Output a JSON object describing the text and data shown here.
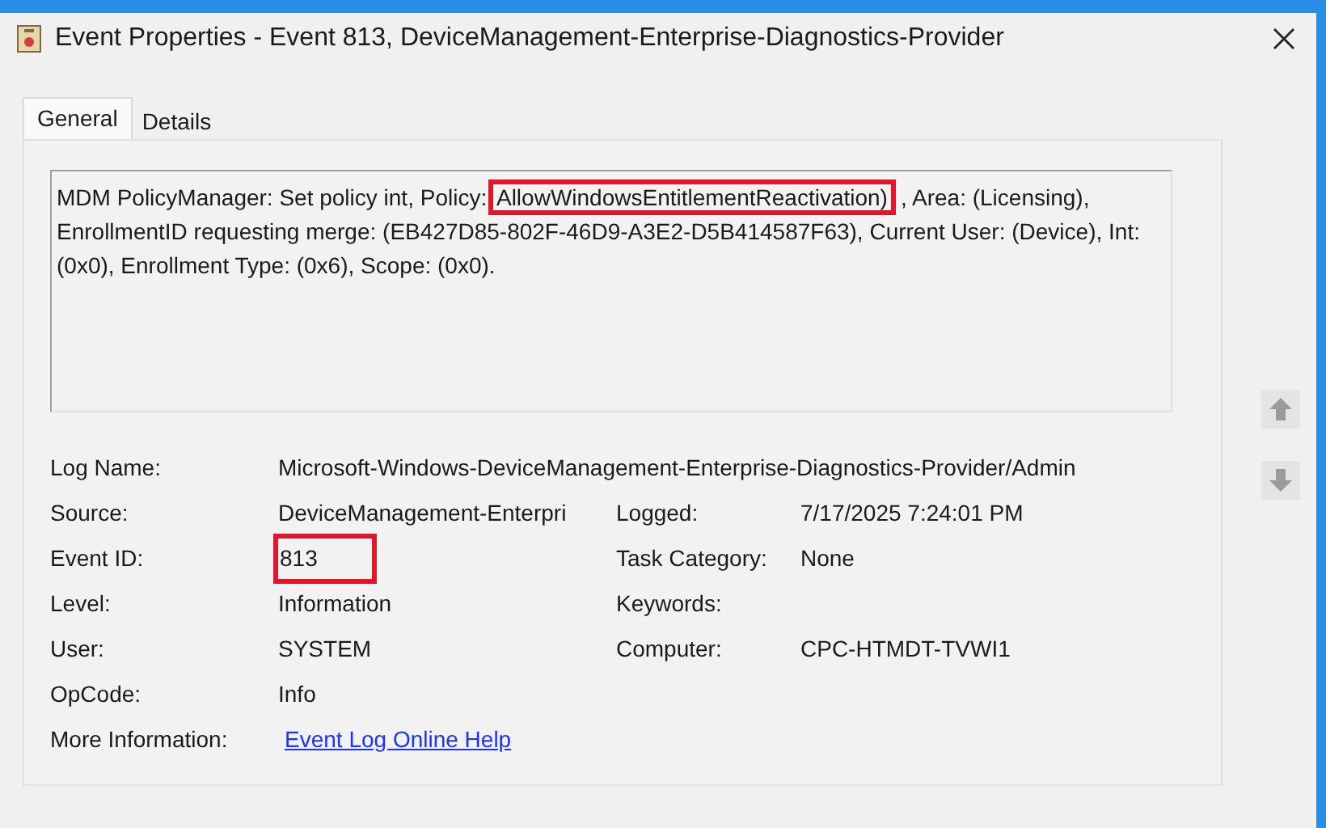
{
  "window": {
    "title": "Event Properties - Event 813, DeviceManagement-Enterprise-Diagnostics-Provider"
  },
  "tabs": [
    {
      "label": "General",
      "selected": true
    },
    {
      "label": "Details",
      "selected": false
    }
  ],
  "message": {
    "parts": [
      {
        "text": "MDM PolicyManager: Set policy int, Policy: ",
        "highlighted": false
      },
      {
        "text": "AllowWindowsEntitlementReactivation)",
        "highlighted": true
      },
      {
        "text": ", Area: (Licensing), EnrollmentID requesting merge: (EB427D85-802F-46D9-A3E2-D5B414587F63), Current User: (Device), Int: (0x0), Enrollment Type: (0x6), Scope: (0x0).",
        "highlighted": false
      }
    ]
  },
  "log_name": {
    "label": "Log Name:",
    "value": "Microsoft-Windows-DeviceManagement-Enterprise-Diagnostics-Provider/Admin"
  },
  "rows": [
    {
      "label": "Source:",
      "value": "DeviceManagement-Enterpri",
      "highlighted": false,
      "label_2": "Logged:",
      "value_2": "7/17/2025 7:24:01 PM"
    },
    {
      "label": "Event ID:",
      "value": "813",
      "highlighted": true,
      "label_2": "Task Category:",
      "value_2": "None"
    },
    {
      "label": "Level:",
      "value": "Information",
      "highlighted": false,
      "label_2": "Keywords:"
    },
    {
      "label": "User:",
      "value": "SYSTEM",
      "highlighted": false,
      "label_2": "Computer:",
      "value_2": "CPC-HTMDT-TVWI1"
    },
    {
      "label": "OpCode:",
      "value": "Info",
      "highlighted": false
    }
  ],
  "more_info": {
    "label": "More Information:",
    "link": "Event Log Online Help"
  }
}
